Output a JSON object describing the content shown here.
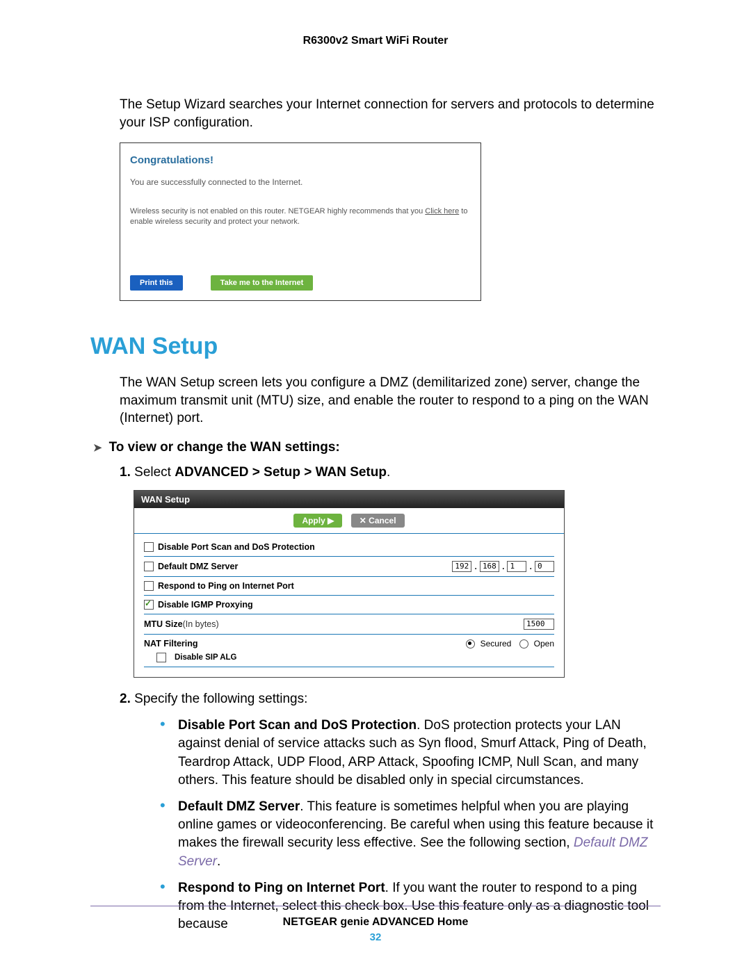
{
  "header": {
    "title": "R6300v2 Smart WiFi Router"
  },
  "intro_para": "The Setup Wizard searches your Internet connection for servers and protocols to determine your ISP configuration.",
  "congrats_box": {
    "title": "Congratulations!",
    "line1": "You are successfully connected to the Internet.",
    "line2_pre": "Wireless security is not enabled on this router. NETGEAR highly recommends that you ",
    "line2_link": "Click here",
    "line2_post": " to enable wireless security and protect your network.",
    "print_btn": "Print this",
    "take_btn": "Take me to the Internet"
  },
  "section_heading": "WAN Setup",
  "wan_para": "The WAN Setup screen lets you configure a DMZ (demilitarized zone) server, change the maximum transmit unit (MTU) size, and enable the router to respond to a ping on the WAN (Internet) port.",
  "arrow_heading": "To view or change the WAN settings:",
  "step1_num": "1.",
  "step1_pre": "Select ",
  "step1_bold": "ADVANCED > Setup > WAN Setup",
  "step1_post": ".",
  "wan_shot": {
    "title": "WAN Setup",
    "apply": "Apply ▶",
    "cancel": "✕ Cancel",
    "row_portscan": "Disable Port Scan and DoS Protection",
    "row_dmz": "Default DMZ Server",
    "ip": [
      "192",
      "168",
      "1",
      "0"
    ],
    "row_ping": "Respond to Ping on Internet Port",
    "row_igmp": "Disable IGMP Proxying",
    "mtu_label": "MTU Size",
    "mtu_unit": "(In bytes)",
    "mtu_val": "1500",
    "nat_label": "NAT Filtering",
    "nat_secured": "Secured",
    "nat_open": "Open",
    "sip": "Disable SIP ALG"
  },
  "step2_num": "2.",
  "step2_text": "Specify the following settings:",
  "bullets": [
    {
      "bold": "Disable Port Scan and DoS Protection",
      "rest": ". DoS protection protects your LAN against denial of service attacks such as Syn flood, Smurf Attack, Ping of Death, Teardrop Attack, UDP Flood, ARP Attack, Spoofing ICMP, Null Scan, and many others. This feature should be disabled only in special circumstances."
    },
    {
      "bold": "Default DMZ Server",
      "rest": ". This feature is sometimes helpful when you are playing online games or videoconferencing. Be careful when using this feature because it makes the firewall security less effective. See the following section, ",
      "link": "Default DMZ Server",
      "tail": "."
    },
    {
      "bold": "Respond to Ping on Internet Port",
      "rest": ". If you want the router to respond to a ping from the Internet, select this check box. Use this feature only as a diagnostic tool because"
    }
  ],
  "footer": {
    "title": "NETGEAR genie ADVANCED Home",
    "page": "32"
  }
}
